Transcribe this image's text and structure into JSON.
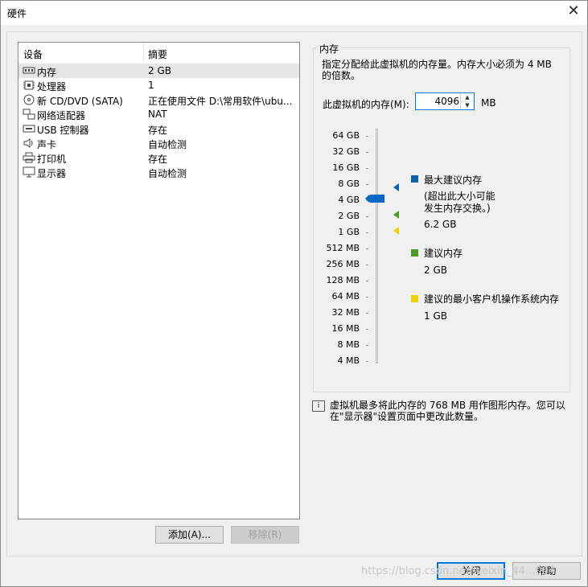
{
  "window": {
    "title": "硬件"
  },
  "device_list": {
    "col_device": "设备",
    "col_summary": "摘要",
    "rows": [
      {
        "name": "内存",
        "summary": "2 GB",
        "icon": "memory-icon"
      },
      {
        "name": "处理器",
        "summary": "1",
        "icon": "cpu-icon"
      },
      {
        "name": "新 CD/DVD (SATA)",
        "summary": "正在使用文件 D:\\常用软件\\ubu...",
        "icon": "cd-icon"
      },
      {
        "name": "网络适配器",
        "summary": "NAT",
        "icon": "network-icon"
      },
      {
        "name": "USB 控制器",
        "summary": "存在",
        "icon": "usb-icon"
      },
      {
        "name": "声卡",
        "summary": "自动检测",
        "icon": "speaker-icon"
      },
      {
        "name": "打印机",
        "summary": "存在",
        "icon": "printer-icon"
      },
      {
        "name": "显示器",
        "summary": "自动检测",
        "icon": "monitor-icon"
      }
    ],
    "add_label": "添加(A)...",
    "remove_label": "移除(R)"
  },
  "memory": {
    "group_title": "内存",
    "description": "指定分配给此虚拟机的内存量。内存大小必须为 4 MB 的倍数。",
    "field_label": "此虚拟机的内存(M):",
    "value": "4096",
    "unit": "MB",
    "scale_labels": [
      "64 GB",
      "32 GB",
      "16 GB",
      "8 GB",
      "4 GB",
      "2 GB",
      "1 GB",
      "512 MB",
      "256 MB",
      "128 MB",
      "64 MB",
      "32 MB",
      "16 MB",
      "8 MB",
      "4 MB"
    ],
    "legend": {
      "max_title": "最大建议内存",
      "max_note": "(超出此大小可能发生内存交换。)",
      "max_value": "6.2 GB",
      "rec_title": "建议内存",
      "rec_value": "2 GB",
      "min_title": "建议的最小客户机操作系统内存",
      "min_value": "1 GB"
    },
    "colors": {
      "max": "#1060b0",
      "rec": "#4a9a2a",
      "min": "#f0d000",
      "thumb": "#0a68c4"
    },
    "info": "虚拟机最多将此内存的 768 MB 用作图形内存。您可以在\"显示器\"设置页面中更改此数量。"
  },
  "footer": {
    "close_label": "关闭",
    "help_label": "帮助",
    "watermark": "https://blog.csdn.net/weixin_44...004"
  }
}
